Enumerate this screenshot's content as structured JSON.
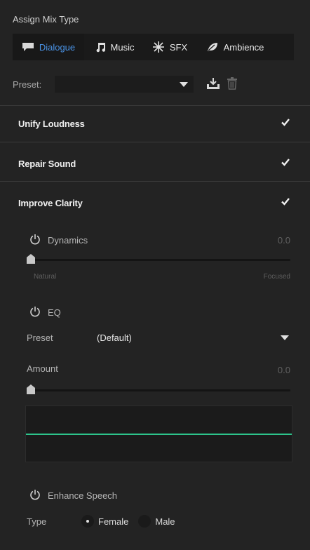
{
  "panel": {
    "header": "Assign Mix Type"
  },
  "tabs": [
    {
      "label": "Dialogue",
      "icon": "speech-bubble-icon",
      "active": true
    },
    {
      "label": "Music",
      "icon": "music-note-icon",
      "active": false
    },
    {
      "label": "SFX",
      "icon": "burst-icon",
      "active": false
    },
    {
      "label": "Ambience",
      "icon": "leaf-icon",
      "active": false
    }
  ],
  "preset": {
    "label": "Preset:",
    "value": ""
  },
  "sections": {
    "unify": {
      "label": "Unify Loudness",
      "checked": true
    },
    "repair": {
      "label": "Repair Sound",
      "checked": true
    },
    "clarity": {
      "label": "Improve Clarity",
      "checked": true
    }
  },
  "dynamics": {
    "label": "Dynamics",
    "value": "0.0",
    "slider": 0.0,
    "min_label": "Natural",
    "max_label": "Focused"
  },
  "eq": {
    "label": "EQ",
    "preset_label": "Preset",
    "preset_value": "(Default)",
    "amount_label": "Amount",
    "amount_value": "0.0",
    "amount_slider": 0.0
  },
  "enhance": {
    "label": "Enhance Speech",
    "type_label": "Type",
    "options": [
      {
        "label": "Female",
        "selected": true
      },
      {
        "label": "Male",
        "selected": false
      }
    ]
  },
  "colors": {
    "accent": "#4a93e6",
    "eq_curve": "#2dc48b",
    "background": "#232323"
  }
}
